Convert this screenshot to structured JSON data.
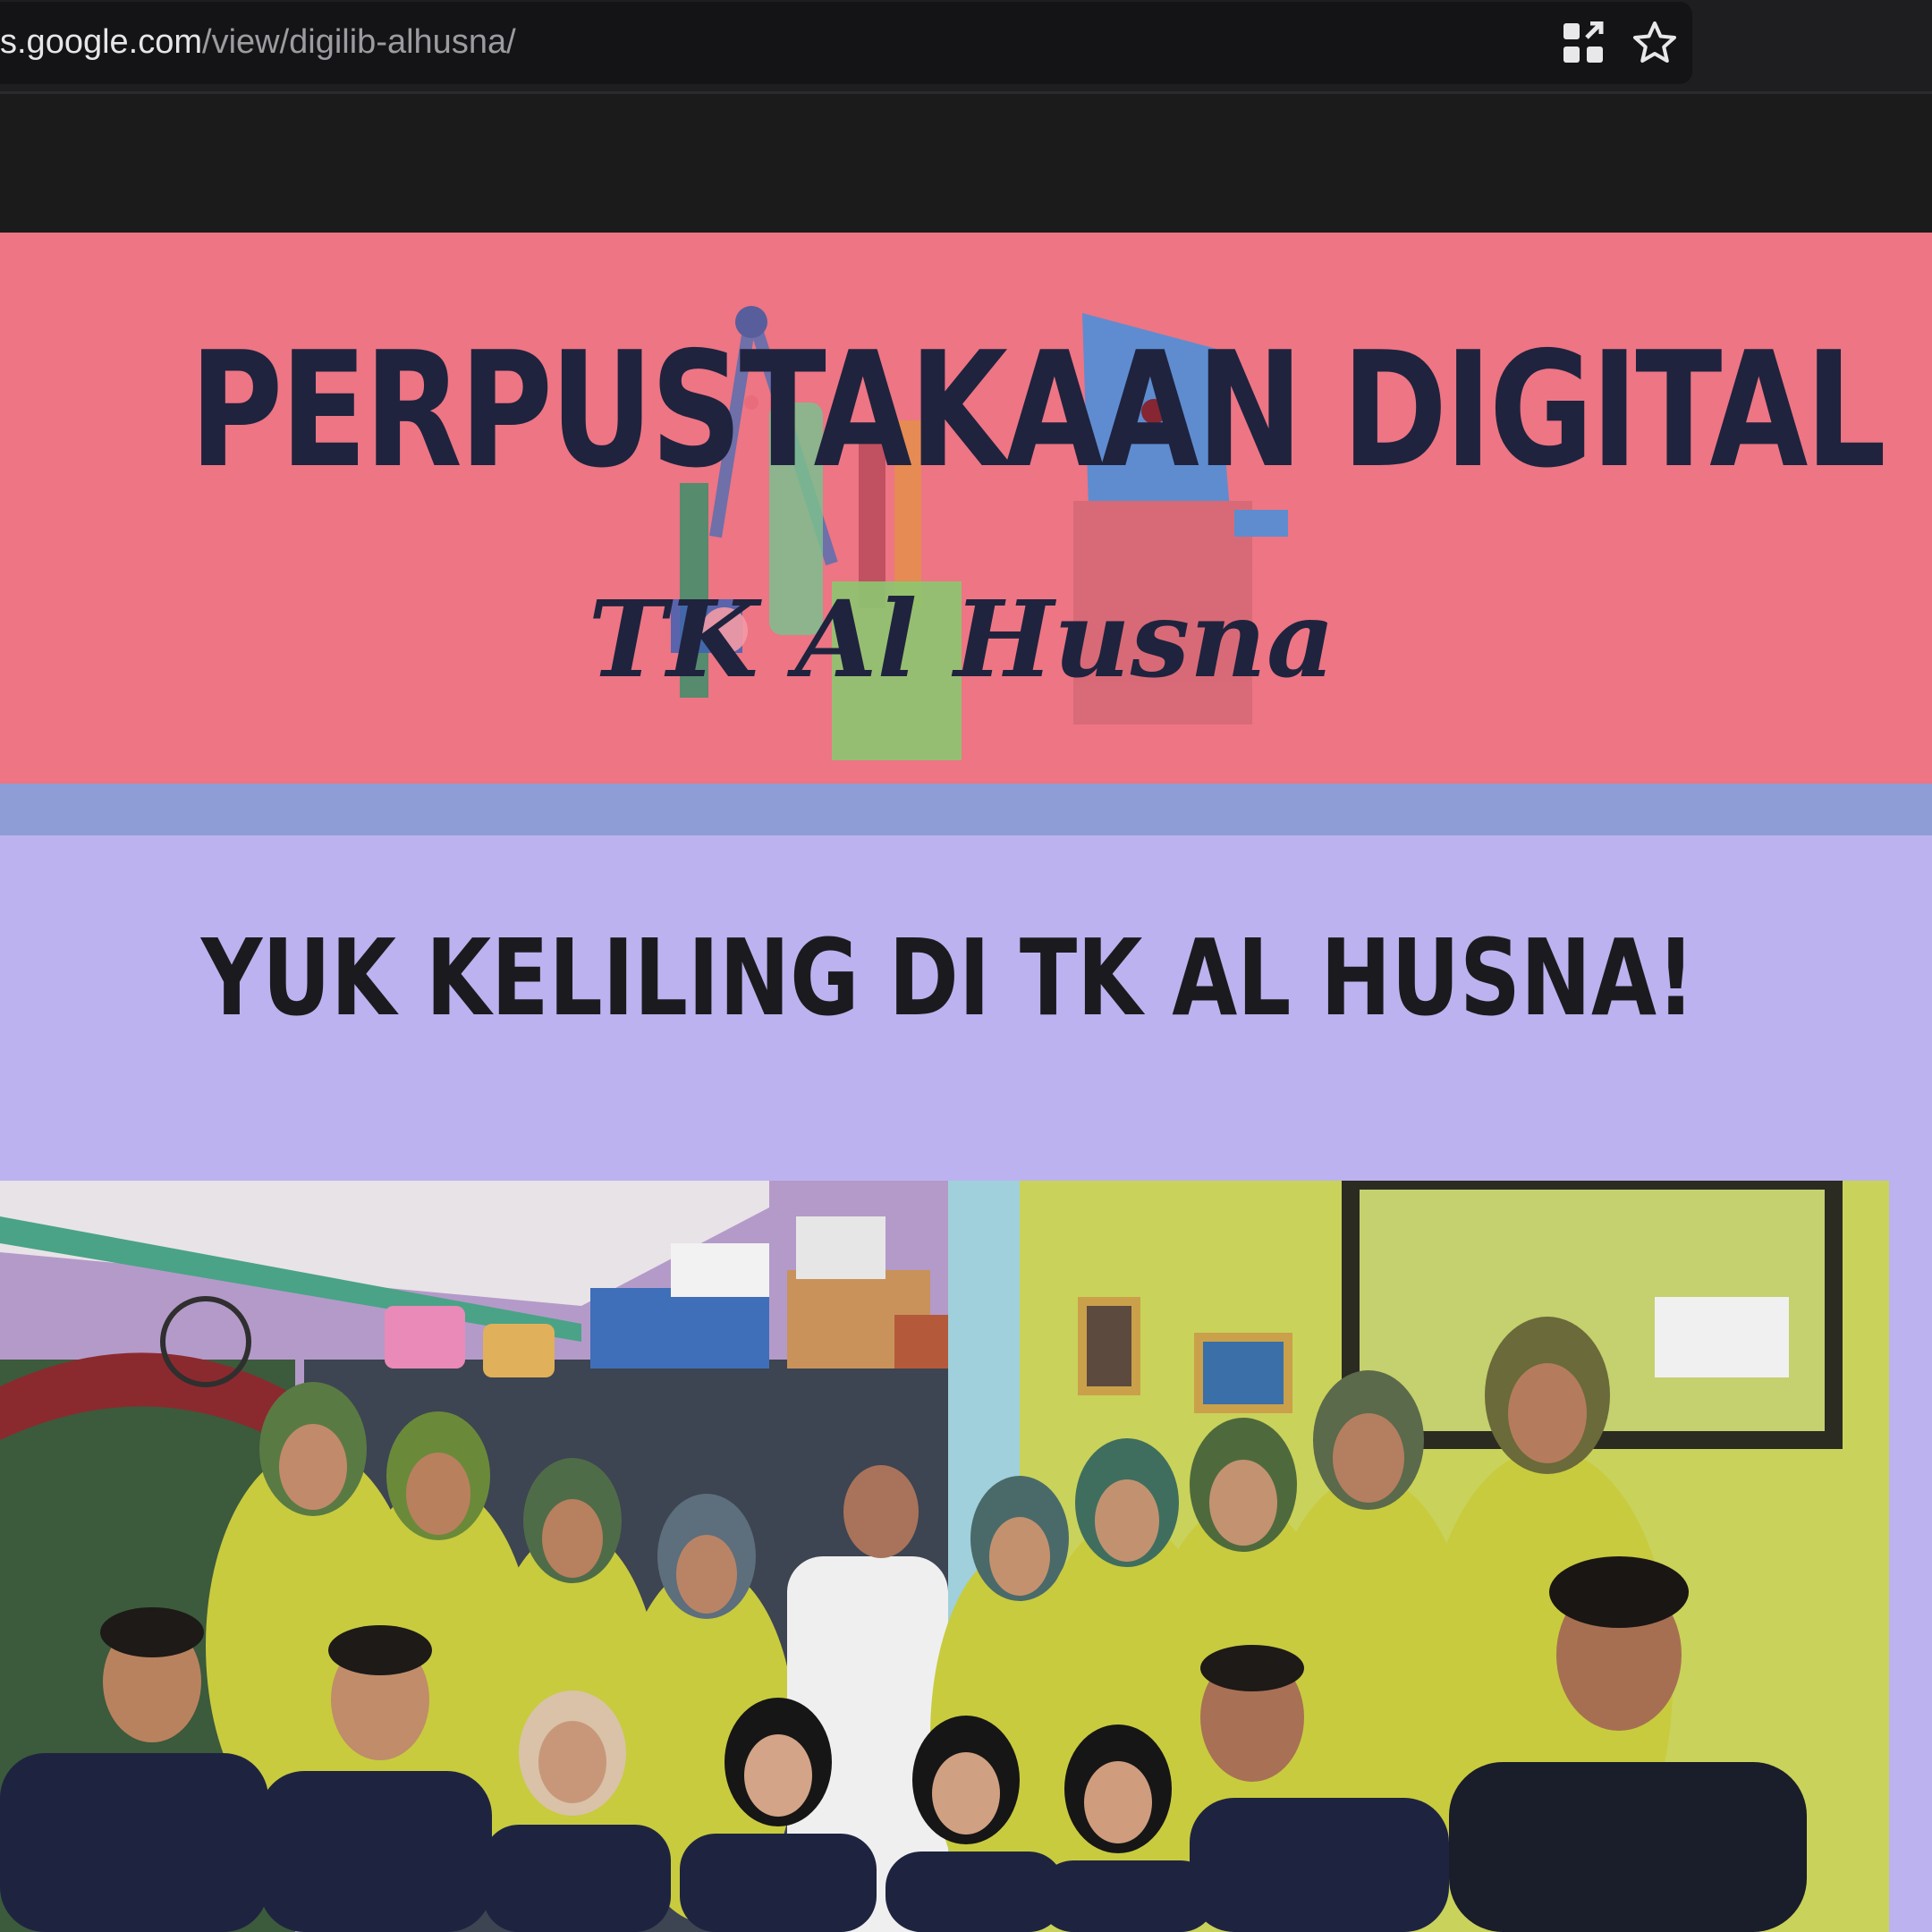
{
  "browser": {
    "url_host": "s.google.com",
    "url_path": "/view/digilib-alhusna/",
    "icons": [
      "qr-code-icon",
      "star-icon"
    ]
  },
  "hero": {
    "title": "PERPUSTAKAAN DIGITAL",
    "subtitle": "TK Al Husna",
    "background_color": "#ed7584",
    "text_color": "#1f233e"
  },
  "section": {
    "heading": "YUK KELILING DI TK AL HUSNA!",
    "background_color": "#bcb2ef",
    "divider_color": "#8e9dd6"
  }
}
